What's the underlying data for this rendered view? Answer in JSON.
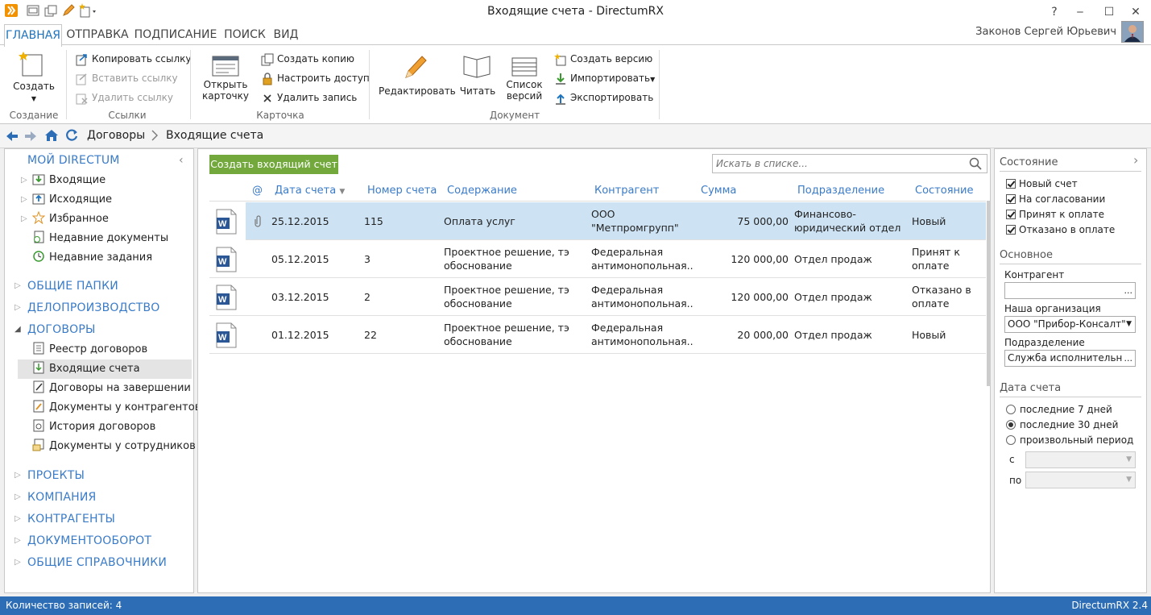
{
  "window": {
    "title": "Входящие счета - DirectumRX",
    "help": "?",
    "minimize": "‒",
    "maximize": "☐",
    "close": "✕"
  },
  "ribbon": {
    "tabs": [
      "ГЛАВНАЯ",
      "ОТПРАВКА",
      "ПОДПИСАНИЕ",
      "ПОИСК",
      "ВИД"
    ],
    "active_tab": "ГЛАВНАЯ",
    "user_name": "Законов Сергей Юрьевич",
    "groups": {
      "create": {
        "label": "Создание",
        "create_btn": "Создать"
      },
      "links": {
        "label": "Ссылки",
        "copy": "Копировать ссылку",
        "paste": "Вставить ссылку",
        "delete": "Удалить ссылку"
      },
      "card": {
        "label": "Карточка",
        "open_l1": "Открыть",
        "open_l2": "карточку",
        "copy": "Создать копию",
        "access": "Настроить доступ",
        "delete": "Удалить запись"
      },
      "document": {
        "label": "Документ",
        "edit": "Редактировать",
        "read": "Читать",
        "versions_l1": "Список",
        "versions_l2": "версий",
        "create_version": "Создать версию",
        "import": "Импортировать",
        "export": "Экспортировать"
      }
    }
  },
  "breadcrumb": {
    "items": [
      "Договоры",
      "Входящие счета"
    ]
  },
  "nav": {
    "my_directum": "МОЙ DIRECTUM",
    "my_items": [
      "Входящие",
      "Исходящие",
      "Избранное",
      "Недавние документы",
      "Недавние задания"
    ],
    "shared_folders": "ОБЩИЕ ПАПКИ",
    "records": "ДЕЛОПРОИЗВОДСТВО",
    "contracts": "ДОГОВОРЫ",
    "contract_items": [
      "Реестр договоров",
      "Входящие счета",
      "Договоры на завершении",
      "Документы у контрагентов",
      "История договоров",
      "Документы у сотрудников"
    ],
    "selected_item": "Входящие счета",
    "other_sections": [
      "ПРОЕКТЫ",
      "КОМПАНИЯ",
      "КОНТРАГЕНТЫ",
      "ДОКУМЕНТООБОРОТ",
      "ОБЩИЕ СПРАВОЧНИКИ"
    ]
  },
  "list": {
    "create_button": "Создать входящий счет",
    "search_placeholder": "Искать в списке...",
    "columns": {
      "attach": "@",
      "date": "Дата счета",
      "number": "Номер счета",
      "content": "Содержание",
      "counterparty": "Контрагент",
      "sum": "Сумма",
      "department": "Подразделение",
      "state": "Состояние"
    },
    "rows": [
      {
        "date": "25.12.2015",
        "number": "115",
        "content": [
          "Оплата услуг",
          ""
        ],
        "counterparty": [
          "ООО",
          "\"Метпромгрупп\""
        ],
        "sum": "75 000,00",
        "department": [
          "Финансово-",
          "юридический отдел"
        ],
        "state": [
          "Новый",
          ""
        ],
        "has_attachment": true,
        "selected": true
      },
      {
        "date": "05.12.2015",
        "number": "3",
        "content": [
          "Проектное решение, тэ",
          "обоснование"
        ],
        "counterparty": [
          "Федеральная",
          "антимонопольная..."
        ],
        "sum": "120 000,00",
        "department": [
          "Отдел продаж",
          ""
        ],
        "state": [
          "Принят к",
          "оплате"
        ],
        "has_attachment": false,
        "selected": false
      },
      {
        "date": "03.12.2015",
        "number": "2",
        "content": [
          "Проектное решение, тэ",
          "обоснование"
        ],
        "counterparty": [
          "Федеральная",
          "антимонопольная..."
        ],
        "sum": "120 000,00",
        "department": [
          "Отдел продаж",
          ""
        ],
        "state": [
          "Отказано в",
          "оплате"
        ],
        "has_attachment": false,
        "selected": false
      },
      {
        "date": "01.12.2015",
        "number": "22",
        "content": [
          "Проектное решение, тэ",
          "обоснование"
        ],
        "counterparty": [
          "Федеральная",
          "антимонопольная..."
        ],
        "sum": "20 000,00",
        "department": [
          "Отдел продаж",
          ""
        ],
        "state": [
          "Новый",
          ""
        ],
        "has_attachment": false,
        "selected": false
      }
    ]
  },
  "filters": {
    "state_title": "Состояние",
    "state_options": [
      "Новый счет",
      "На согласовании",
      "Принят к оплате",
      "Отказано в оплате"
    ],
    "main_title": "Основное",
    "counterparty_label": "Контрагент",
    "counterparty_value": "",
    "org_label": "Наша организация",
    "org_value": "ООО \"Прибор-Консалт\"",
    "dept_label": "Подразделение",
    "dept_value": "Служба исполнительного",
    "date_title": "Дата счета",
    "date_options": [
      "последние 7 дней",
      "последние 30 дней",
      "произвольный период"
    ],
    "date_selected": "последние 30 дней",
    "from_label": "с",
    "to_label": "по",
    "ellipsis": "...",
    "chevron": "›"
  },
  "status": {
    "count_text": "Количество записей: 4",
    "version": "DirectumRX 2.4"
  }
}
